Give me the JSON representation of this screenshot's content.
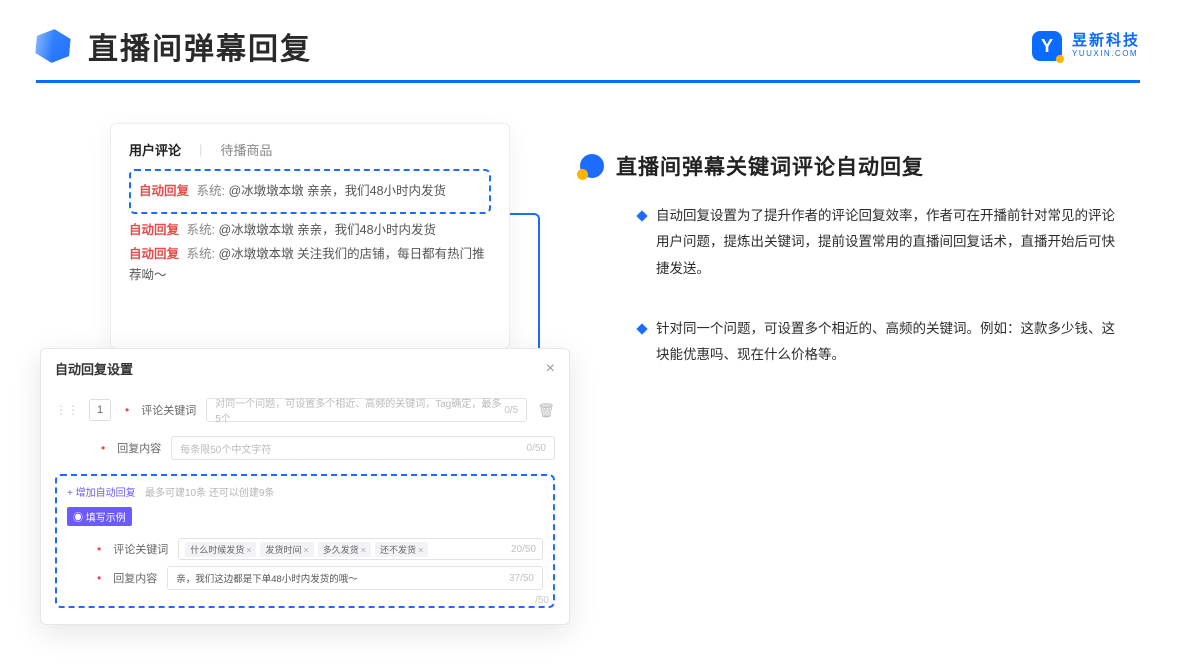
{
  "header": {
    "page_title": "直播间弹幕回复",
    "logo_cn": "昱新科技",
    "logo_en": "YUUXIN.COM",
    "logo_initial": "Y"
  },
  "comments_panel": {
    "tab_a": "用户评论",
    "tab_b": "待播商品",
    "highlight": {
      "tag": "自动回复",
      "system": "系统:",
      "text": "@冰墩墩本墩 亲亲，我们48小时内发货"
    },
    "line2": {
      "tag": "自动回复",
      "system": "系统:",
      "text": "@冰墩墩本墩 亲亲，我们48小时内发货"
    },
    "line3": {
      "tag": "自动回复",
      "system": "系统:",
      "text": "@冰墩墩本墩 关注我们的店铺，每日都有热门推荐呦～"
    }
  },
  "modal": {
    "title": "自动回复设置",
    "index": "1",
    "row1_label": "评论关键词",
    "row1_placeholder": "对同一个问题，可设置多个相近、高频的关键词，Tag确定，最多5个",
    "row1_counter": "0/5",
    "row2_label": "回复内容",
    "row2_placeholder": "每条限50个中文字符",
    "row2_counter": "0/50",
    "add_link": "+ 增加自动回复",
    "add_hint": "最多可建10条 还可以创建9条",
    "badge": "◉ 填写示例",
    "ex_label1": "评论关键词",
    "chips": [
      "什么时候发货",
      "发货时间",
      "多久发货",
      "还不发货"
    ],
    "ex_counter1": "20/50",
    "ex_label2": "回复内容",
    "ex_value2": "亲，我们这边都是下单48小时内发货的哦～",
    "ex_counter2": "37/50",
    "outer_counter": "/50"
  },
  "right": {
    "title": "直播间弹幕关键词评论自动回复",
    "bullet1": "自动回复设置为了提升作者的评论回复效率，作者可在开播前针对常见的评论用户问题，提炼出关键词，提前设置常用的直播间回复话术，直播开始后可快捷发送。",
    "bullet2": "针对同一个问题，可设置多个相近的、高频的关键词。例如：这款多少钱、这块能优惠吗、现在什么价格等。"
  }
}
